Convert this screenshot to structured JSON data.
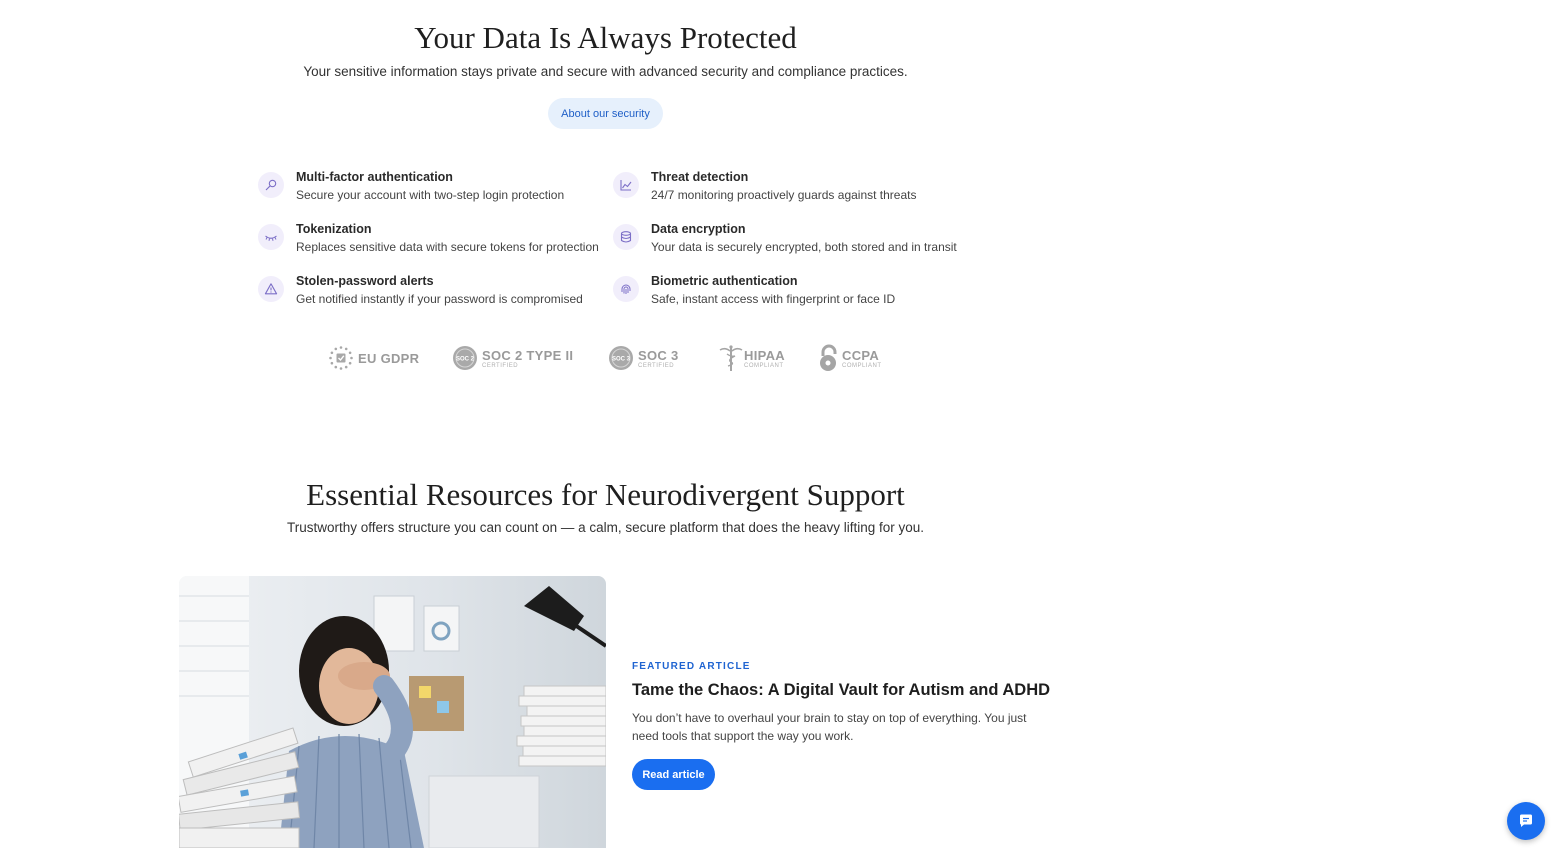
{
  "security": {
    "title": "Your Data Is Always Protected",
    "subtitle": "Your sensitive information stays private and secure with advanced security and compliance practices.",
    "button_label": "About our security",
    "features": [
      {
        "title": "Multi-factor authentication",
        "desc": "Secure your account with two-step login protection",
        "icon": "key-icon"
      },
      {
        "title": "Threat detection",
        "desc": "24/7 monitoring proactively guards against threats",
        "icon": "chart-line-icon"
      },
      {
        "title": "Tokenization",
        "desc": "Replaces sensitive data with secure tokens for protection",
        "icon": "eye-closed-icon"
      },
      {
        "title": "Data encryption",
        "desc": "Your data is securely encrypted, both stored and in transit",
        "icon": "database-icon"
      },
      {
        "title": "Stolen-password alerts",
        "desc": "Get notified instantly if your password is compromised",
        "icon": "warning-icon"
      },
      {
        "title": "Biometric authentication",
        "desc": "Safe, instant access with fingerprint or face ID",
        "icon": "fingerprint-icon"
      }
    ],
    "badges": [
      {
        "name": "EU GDPR",
        "sub": ""
      },
      {
        "name": "SOC 2 TYPE II",
        "sub": "CERTIFIED"
      },
      {
        "name": "SOC 3",
        "sub": "CERTIFIED"
      },
      {
        "name": "HIPAA",
        "sub": "COMPLIANT"
      },
      {
        "name": "CCPA",
        "sub": "COMPLIANT"
      }
    ]
  },
  "resources": {
    "title": "Essential Resources for Neurodivergent Support",
    "subtitle": "Trustworthy offers structure you can count on — a calm, secure platform that does the heavy lifting for you.",
    "article": {
      "kicker": "FEATURED ARTICLE",
      "title": "Tame the Chaos: A Digital Vault for Autism and ADHD",
      "desc": "You don’t have to overhaul your brain to stay on top of everything. You just need tools that support the way you work.",
      "button_label": "Read article"
    }
  },
  "colors": {
    "accent": "#1a6ef0",
    "pill_bg": "#e6f0fc",
    "icon_bg": "#f1eefb",
    "icon_stroke": "#7c6fc7"
  }
}
